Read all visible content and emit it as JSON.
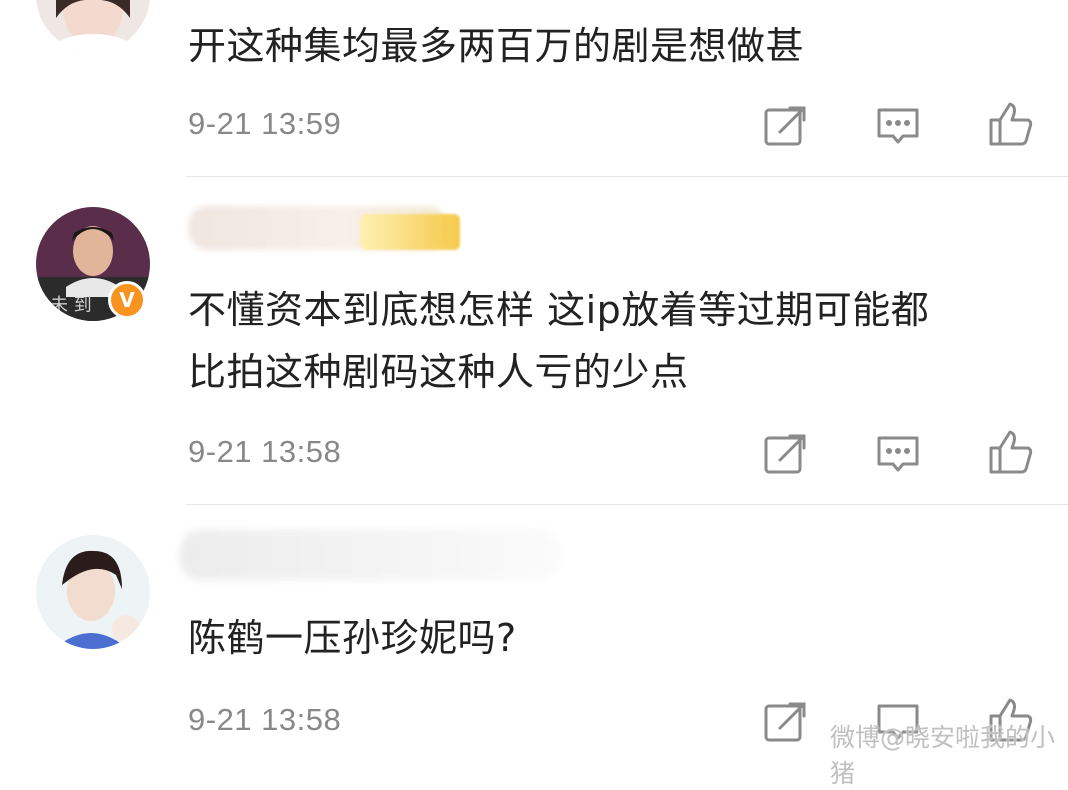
{
  "comments": [
    {
      "text": "开这种集均最多两百万的剧是想做甚",
      "time": "9-21 13:59"
    },
    {
      "text_line1": "不懂资本到底想怎样 这ip放着等过期可能都",
      "text_line2": "比拍这种剧码这种人亏的少点",
      "time": "9-21 13:58",
      "verified_badge": "V"
    },
    {
      "text": "陈鹤一压孙珍妮吗?",
      "time": "9-21 13:58"
    }
  ],
  "icons": {
    "repost": "repost-icon",
    "comment": "comment-icon",
    "like": "like-icon"
  },
  "watermark": "微博@晓安啦我的小猪",
  "colors": {
    "text": "#222222",
    "meta": "#888888",
    "icon": "#888888",
    "badge": "#f7931e"
  }
}
